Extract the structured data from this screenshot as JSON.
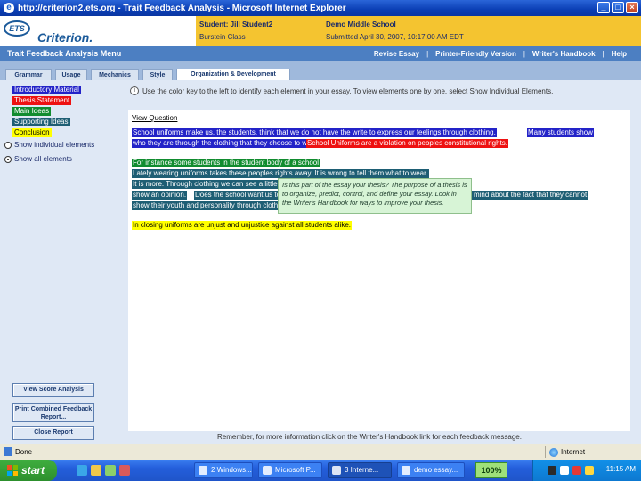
{
  "window": {
    "title": "http://criterion2.ets.org - Trait Feedback Analysis - Microsoft Internet Explorer",
    "icon": "ie-icon",
    "buttons": [
      "_",
      "□",
      "×"
    ]
  },
  "header": {
    "logo_ets": "ETS",
    "logo_product": "Criterion.",
    "student": "Student: Jill Student2",
    "class": "Burstein Class",
    "school": "Demo Middle School",
    "submitted": "Submitted April 30, 2007, 10:17:00 AM EDT"
  },
  "menubar": {
    "title": "Trait Feedback Analysis Menu",
    "links": [
      "Revise Essay",
      "Printer-Friendly Version",
      "Writer's Handbook",
      "Help"
    ],
    "separator": "|"
  },
  "tabs": [
    {
      "label": "Grammar",
      "active": false
    },
    {
      "label": "Usage",
      "active": false
    },
    {
      "label": "Mechanics",
      "active": false
    },
    {
      "label": "Style",
      "active": false
    },
    {
      "label": "Organization & Development",
      "active": true
    }
  ],
  "legend": [
    {
      "label": "Introductory Material",
      "color": "#2323c8",
      "text_color": "#ffffff"
    },
    {
      "label": "Thesis Statement",
      "color": "#ee1111",
      "text_color": "#ffffff"
    },
    {
      "label": "Main Ideas",
      "color": "#118c2f",
      "text_color": "#ffffff"
    },
    {
      "label": "Supporting Ideas",
      "color": "#1e5e74",
      "text_color": "#ffffff"
    },
    {
      "label": "Conclusion",
      "color": "#ffff00",
      "text_color": "#000000"
    }
  ],
  "view_options": [
    {
      "label": "Show individual elements",
      "checked": false
    },
    {
      "label": "Show all elements",
      "checked": true
    }
  ],
  "side_buttons": [
    "View Score Analysis",
    "Print Combined Feedback Report...",
    "Close Report"
  ],
  "info_line": "Use the color key to the left to identify each element in your essay. To view elements one by one, select Show Individual Elements.",
  "essay": {
    "view_question": "View Question",
    "lines": [
      {
        "segments": [
          {
            "text": "School uniforms make us, the students, think that we do not have the write to express our feelings through clothing.",
            "style": "blue"
          },
          {
            "text": "Many students show",
            "style": "blue"
          }
        ]
      },
      {
        "segments": [
          {
            "text": "who they are through the clothing that they choose to wear.",
            "style": "blue"
          },
          {
            "text": "School Uniforms are a violation on peoples constitutional rights.",
            "style": "red"
          }
        ]
      },
      {
        "segments": [
          {
            "text": "For instance some students in the student body of a school",
            "style": "green"
          }
        ]
      },
      {
        "segments": [
          {
            "text": "Lately wearing uniforms takes these peoples rights away. It is wrong to tell them what to wear.",
            "style": "teal"
          }
        ]
      },
      {
        "segments": [
          {
            "text": "It is more. Through clothing we can see a little",
            "style": "teal"
          }
        ]
      },
      {
        "segments": [
          {
            "text": "show an opinion.",
            "style": "teal"
          },
          {
            "text": "Does the school want us to look exactly alike?",
            "style": "teal"
          },
          {
            "text": "Some students may not have an open mind about the fact that they cannot",
            "style": "teal"
          }
        ]
      },
      {
        "segments": [
          {
            "text": "show their youth and personality through clothing they will show it in another unless it is way.",
            "style": "teal"
          }
        ]
      },
      {
        "segments": [
          {
            "text": "In closing uniforms are unjust and unjustice against all students alike.",
            "style": "yellow"
          }
        ]
      }
    ],
    "tooltip": "Is this part of the essay your thesis? The purpose of a thesis is to organize, predict, control, and define your essay. Look in the Writer's Handbook for ways to improve your thesis."
  },
  "footer_note": "Remember, for more information click on the Writer's Handbook link for each feedback message.",
  "statusbar": {
    "left": "Done",
    "right": "Internet"
  },
  "taskbar": {
    "start": "start",
    "items": [
      {
        "label": "2 Windows...",
        "active": false
      },
      {
        "label": "Microsoft P...",
        "active": false
      },
      {
        "label": "3 Interne...",
        "active": true
      },
      {
        "label": "demo essay...",
        "active": false
      }
    ],
    "zoom": "100%",
    "clock": "11:15 AM"
  }
}
